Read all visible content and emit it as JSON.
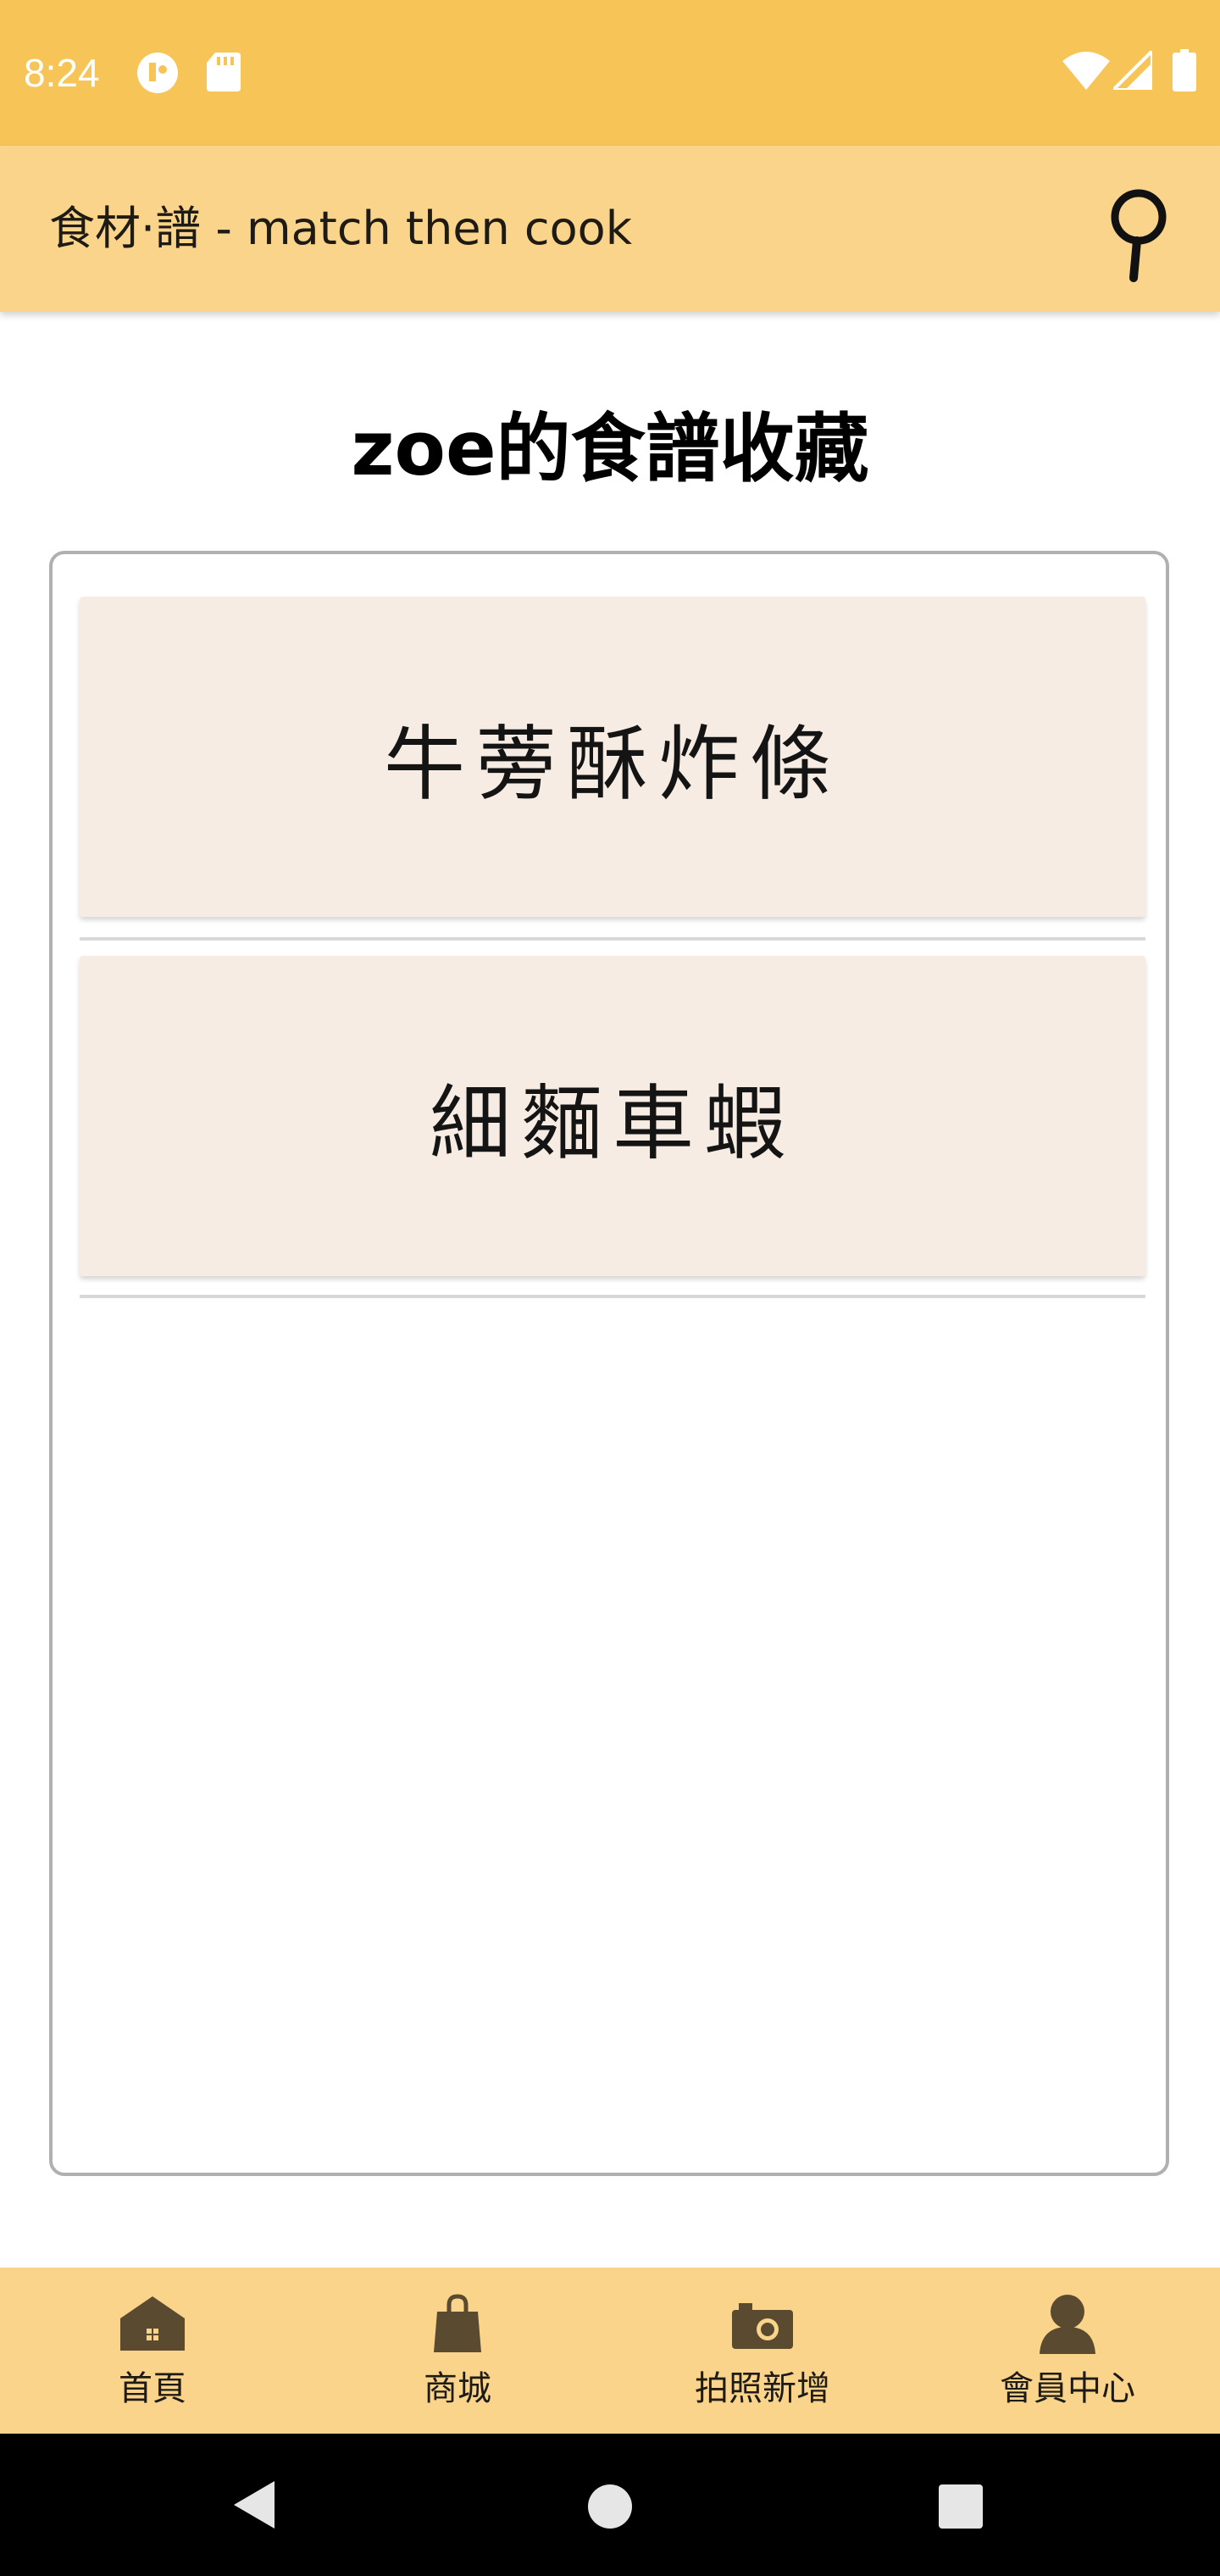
{
  "status_bar": {
    "time": "8:24",
    "icons": [
      "messenger-icon",
      "sd-card-icon",
      "wifi-icon",
      "signal-icon",
      "battery-icon"
    ]
  },
  "app_bar": {
    "title": "食材·譜 - match then cook",
    "search_icon": "magnifier-icon"
  },
  "page": {
    "title": "zoe的食譜收藏"
  },
  "recipes": [
    {
      "name": "牛蒡酥炸條"
    },
    {
      "name": "細麵車蝦"
    }
  ],
  "bottom_nav": {
    "items": [
      {
        "label": "首頁",
        "icon": "home-icon"
      },
      {
        "label": "商城",
        "icon": "shopping-bag-icon"
      },
      {
        "label": "拍照新增",
        "icon": "camera-icon"
      },
      {
        "label": "會員中心",
        "icon": "member-icon"
      }
    ]
  },
  "system_nav": {
    "icons": [
      "back-icon",
      "home-circle-icon",
      "recents-icon"
    ]
  },
  "colors": {
    "status_bar": "#f7c557",
    "app_bar": "#f9d48a",
    "card": "#f6ece3",
    "icon_brown": "#5a4a30"
  }
}
